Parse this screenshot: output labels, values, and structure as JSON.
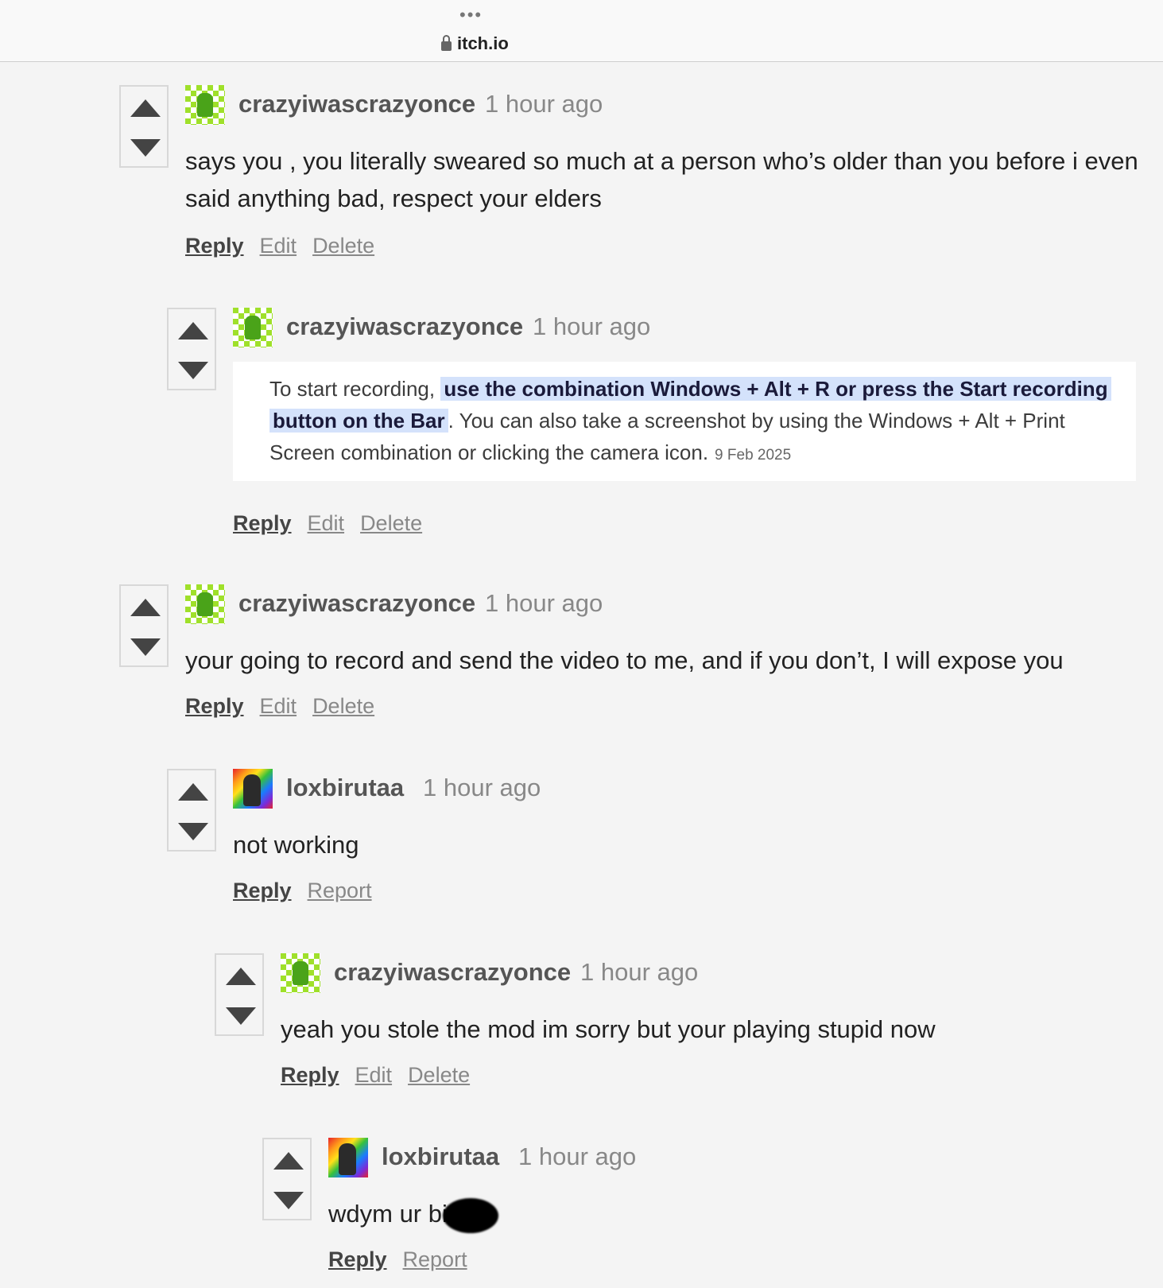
{
  "browser": {
    "url": "itch.io"
  },
  "comments": [
    {
      "author": "crazyiwascrazyonce",
      "time": "1 hour ago",
      "text_line1": "says you , you literally sweared so much at a person who’s older than you before i even",
      "text_line2": "said anything bad, respect your elders",
      "actions": [
        "Reply",
        "Edit",
        "Delete"
      ]
    },
    {
      "author": "crazyiwascrazyonce",
      "time": "1 hour ago",
      "quote": {
        "prefix": "To start recording, ",
        "highlight_line1": "use the combination Windows + Alt + R or press the Start recording",
        "highlight_line2": "button on the Bar",
        "suffix": ". You can also take a screenshot by using the Windows + Alt + Print Screen combination or clicking the camera icon.",
        "date": "9 Feb 2025"
      },
      "actions": [
        "Reply",
        "Edit",
        "Delete"
      ]
    },
    {
      "author": "crazyiwascrazyonce",
      "time": "1 hour ago",
      "text": "your going to record and send the video to me, and if you don’t, I will expose you",
      "actions": [
        "Reply",
        "Edit",
        "Delete"
      ]
    },
    {
      "author": "loxbirutaa",
      "time": "1 hour ago",
      "text": "not working",
      "actions": [
        "Reply",
        "Report"
      ]
    },
    {
      "author": "crazyiwascrazyonce",
      "time": "1 hour ago",
      "text": "yeah you stole the mod im sorry but your playing stupid now",
      "actions": [
        "Reply",
        "Edit",
        "Delete"
      ]
    },
    {
      "author": "loxbirutaa",
      "time": "1 hour ago",
      "text": "wdym ur bi",
      "actions": [
        "Reply",
        "Report"
      ]
    }
  ]
}
